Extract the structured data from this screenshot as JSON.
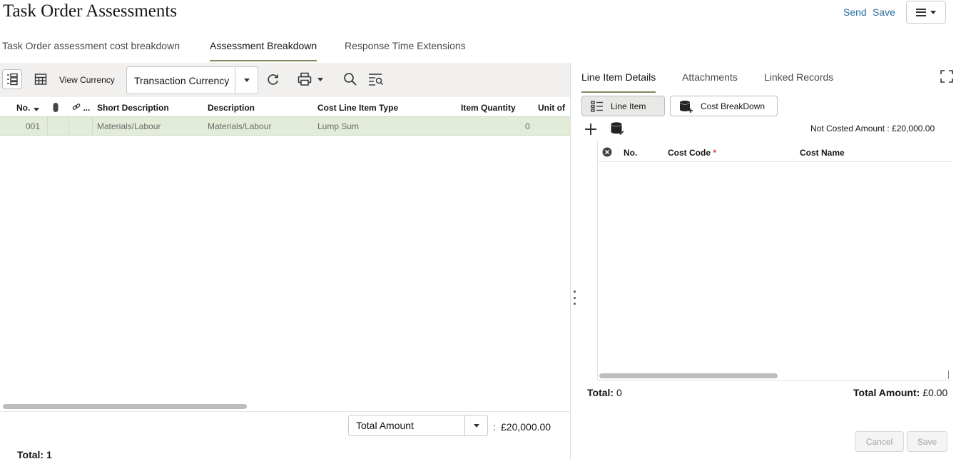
{
  "header": {
    "title": "Task Order Assessments",
    "send_label": "Send",
    "save_label": "Save"
  },
  "tabs": [
    {
      "label": "Task Order assessment cost breakdown"
    },
    {
      "label": "Assessment Breakdown",
      "active": true
    },
    {
      "label": "Response Time Extensions"
    }
  ],
  "left": {
    "toolbar": {
      "view_currency_label": "View Currency",
      "currency_value": "Transaction Currency"
    },
    "columns": [
      "No.",
      "Short Description",
      "Description",
      "Cost Line Item Type",
      "Item Quantity",
      "Unit of"
    ],
    "link_col_label": "...",
    "rows": [
      {
        "no": "001",
        "short_description": "Materials/Labour",
        "description": "Materials/Labour",
        "cost_line_item_type": "Lump Sum",
        "item_quantity": "0"
      }
    ],
    "footer": {
      "amount_select": "Total Amount",
      "amount_colon": ":",
      "amount_value": "£20,000.00",
      "total_label": "Total: 1"
    }
  },
  "right": {
    "tabs": [
      {
        "label": "Line Item Details",
        "active": true
      },
      {
        "label": "Attachments"
      },
      {
        "label": "Linked Records"
      }
    ],
    "buttons": {
      "line_item": "Line Item",
      "cost_breakdown": "Cost BreakDown"
    },
    "not_costed": "Not Costed Amount : £20,000.00",
    "columns": {
      "no": "No.",
      "cost_code": "Cost Code",
      "cost_code_required": "*",
      "cost_name": "Cost Name"
    },
    "footer": {
      "total_label": "Total:",
      "total_value": "0",
      "total_amount_label": "Total Amount:",
      "total_amount_value": "£0.00"
    },
    "actions": {
      "cancel": "Cancel",
      "save": "Save"
    }
  },
  "colors": {
    "accent": "#7d8a5f",
    "link": "#2a6c9c",
    "selected_row": "#e3ecd9",
    "toolbar_bg": "#f1f0ee"
  }
}
